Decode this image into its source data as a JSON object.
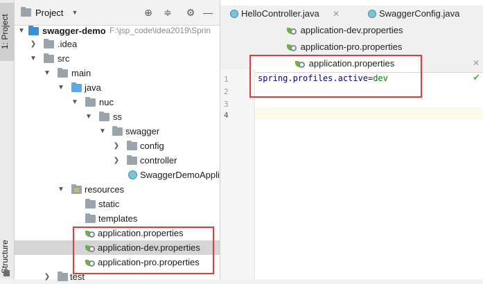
{
  "sidebar": {
    "tab_project": "1: Project",
    "tab_structure": "Structure"
  },
  "project_panel": {
    "title": "Project",
    "tree": [
      {
        "label": "swagger-demo",
        "path": "F:\\jsp_code\\idea2019\\Sprin"
      },
      {
        "label": ".idea"
      },
      {
        "label": "src"
      },
      {
        "label": "main"
      },
      {
        "label": "java"
      },
      {
        "label": "nuc"
      },
      {
        "label": "ss"
      },
      {
        "label": "swagger"
      },
      {
        "label": "config"
      },
      {
        "label": "controller"
      },
      {
        "label": "SwaggerDemoAppli"
      },
      {
        "label": "resources"
      },
      {
        "label": "static"
      },
      {
        "label": "templates"
      },
      {
        "label": "application.properties"
      },
      {
        "label": "application-dev.properties"
      },
      {
        "label": "application-pro.properties"
      },
      {
        "label": "test"
      }
    ]
  },
  "editor": {
    "tabs_row1": [
      "HelloController.java",
      "SwaggerConfig.java"
    ],
    "tabs_row2": "application-dev.properties",
    "tabs_row3": "application-pro.properties",
    "tabs_row4": "application.properties",
    "line_numbers": [
      "1",
      "2",
      "3",
      "4"
    ],
    "code": {
      "key": "spring.profiles.active",
      "eq": "=",
      "value": "dev"
    }
  },
  "colors": {
    "highlight_box": "#e53935",
    "spring_green": "#6db33f"
  }
}
